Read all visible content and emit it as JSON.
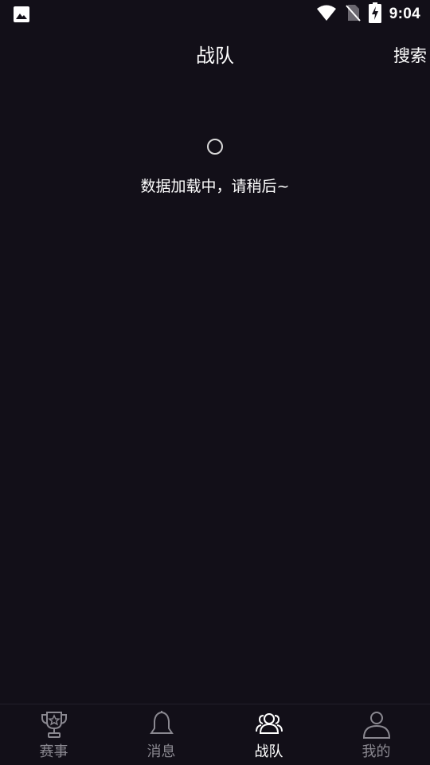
{
  "status_bar": {
    "time": "9:04",
    "icons": [
      "image-icon",
      "wifi-icon",
      "no-sim-icon",
      "battery-charging-icon"
    ]
  },
  "header": {
    "title": "战队",
    "search_label": "搜索"
  },
  "loading": {
    "text": "数据加载中，请稍后~"
  },
  "bottom_nav": {
    "items": [
      {
        "label": "赛事",
        "icon": "trophy-icon",
        "active": false
      },
      {
        "label": "消息",
        "icon": "bell-icon",
        "active": false
      },
      {
        "label": "战队",
        "icon": "team-icon",
        "active": true
      },
      {
        "label": "我的",
        "icon": "user-icon",
        "active": false
      }
    ]
  },
  "colors": {
    "background": "#120f18",
    "text_primary": "#ffffff",
    "text_inactive": "#8a8890"
  }
}
